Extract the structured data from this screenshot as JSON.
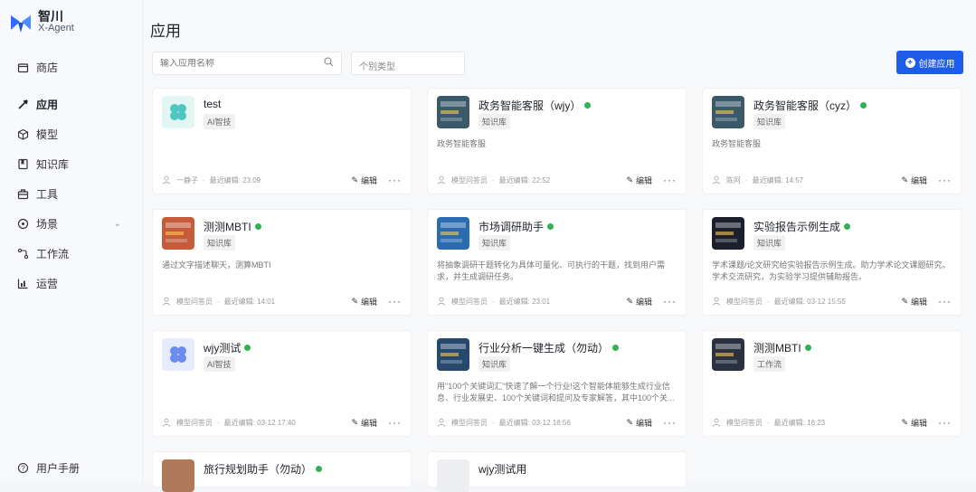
{
  "brand": {
    "name": "智川",
    "sub": "X-Agent"
  },
  "nav": [
    {
      "label": "商店",
      "icon": "store-icon"
    },
    {
      "label": "应用",
      "icon": "rocket-icon"
    },
    {
      "label": "模型",
      "icon": "cube-icon"
    },
    {
      "label": "知识库",
      "icon": "book-icon"
    },
    {
      "label": "工具",
      "icon": "toolbox-icon"
    },
    {
      "label": "场景",
      "icon": "scene-icon"
    },
    {
      "label": "工作流",
      "icon": "workflow-icon"
    },
    {
      "label": "运营",
      "icon": "chart-icon"
    }
  ],
  "footer": {
    "label": "用户手册",
    "icon": "help-icon"
  },
  "page": {
    "title": "应用",
    "search_placeholder": "输入应用名称",
    "select_value": "个别类型",
    "create_label": "创建应用"
  },
  "cards": [
    {
      "title": "test",
      "tag": "AI智技",
      "desc": "",
      "author": "一静子",
      "time": "最近编辑: 23:09",
      "icon_color": "#4fc7c0",
      "status": false
    },
    {
      "title": "政务智能客服（wjy）",
      "tag": "知识库",
      "desc": "政务智能客服",
      "author": "模型问答员",
      "time": "最近编辑: 22:52",
      "icon_color": "#3a5a6b",
      "status": true
    },
    {
      "title": "政务智能客服（cyz）",
      "tag": "知识库",
      "desc": "政务智能客服",
      "author": "陈阿",
      "time": "最近编辑: 14:57",
      "icon_color": "#3a5a6b",
      "status": true
    },
    {
      "title": "测测MBTI",
      "tag": "知识库",
      "desc": "通过文字描述聊天，测算MBTI",
      "author": "模型问答员",
      "time": "最近编辑: 14:01",
      "icon_color": "#c65b3a",
      "status": true
    },
    {
      "title": "市场调研助手",
      "tag": "知识库",
      "desc": "将抽象调研干题转化为具体可量化、可执行的干题，找到用户需求，并生成调研任务。",
      "author": "模型问答员",
      "time": "最近编辑: 23:01",
      "icon_color": "#2b6cb0",
      "status": true
    },
    {
      "title": "实验报告示例生成",
      "tag": "知识库",
      "desc": "学术课题/论文研究给实验报告示例生成。助力学术论文课题研究。学术交流研究，为实验学习提供辅助报告。",
      "author": "模型问答员",
      "time": "最近编辑: 03-12 15:55",
      "icon_color": "#1a1f2b",
      "status": true
    },
    {
      "title": "wjy测试",
      "tag": "AI智技",
      "desc": "",
      "author": "模型问答员",
      "time": "最近编辑: 03-12 17:40",
      "icon_color": "#6b8cf0",
      "status": true
    },
    {
      "title": "行业分析一键生成（勿动）",
      "tag": "知识库",
      "desc": "用\"100个关键词汇\"快速了解一个行业!这个智能体能够生成行业信息、行业发展史、100个关键词和提问及专家解答，其中100个关...",
      "author": "模型问答员",
      "time": "最近编辑: 03-12 16:56",
      "icon_color": "#27496d",
      "status": true
    },
    {
      "title": "测测MBTI",
      "tag": "工作流",
      "desc": "",
      "author": "模型问答员",
      "time": "最近编辑: 16:23",
      "icon_color": "#2a3242",
      "status": true
    }
  ],
  "partial_cards": [
    {
      "title": "旅行规划助手（勿动）"
    },
    {
      "title": "wjy测试用"
    }
  ],
  "edit_label": "编辑",
  "more_label": "···"
}
